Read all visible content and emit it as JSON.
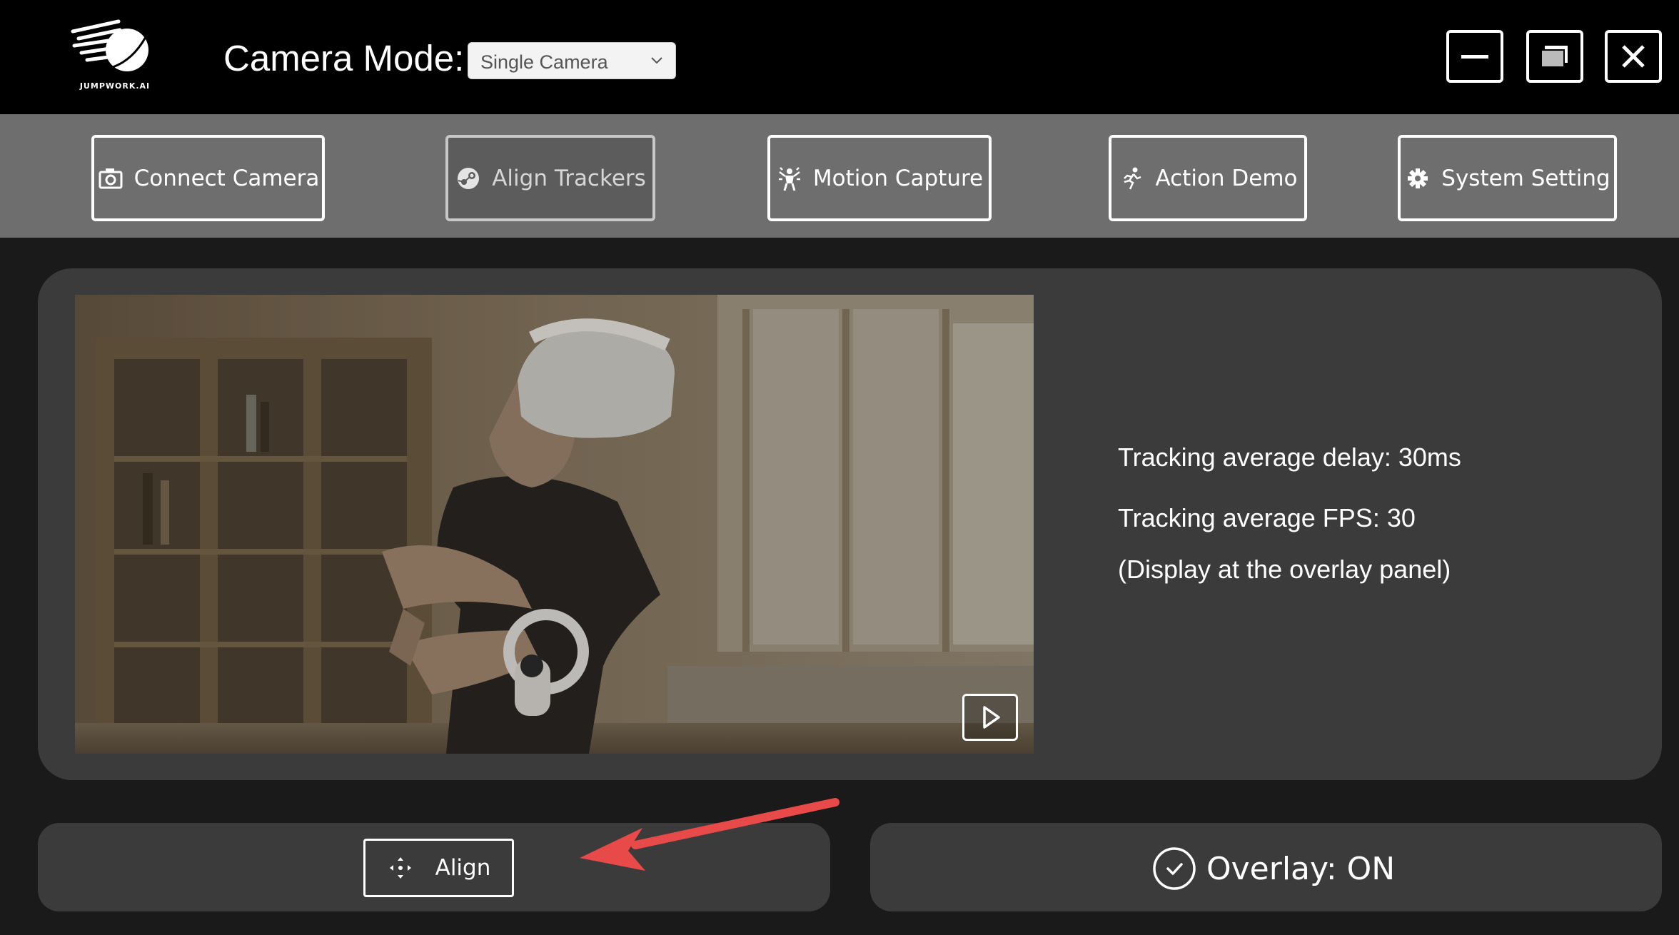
{
  "app": {
    "logo_text": "JUMPWORK.AI",
    "camera_mode_label": "Camera Mode:",
    "camera_mode_value": "Single Camera"
  },
  "window_controls": {
    "icons": [
      "minimize-icon",
      "restore-icon",
      "close-icon"
    ]
  },
  "toolbar": {
    "connect_camera": "Connect Camera",
    "align_trackers": "Align Trackers",
    "motion_capture": "Motion Capture",
    "action_demo": "Action Demo",
    "system_setting": "System Setting"
  },
  "stats": {
    "delay": "Tracking average delay: 30ms",
    "fps": "Tracking average FPS: 30",
    "note": "(Display at the overlay panel)"
  },
  "actions": {
    "align_label": "Align",
    "overlay_label": "Overlay: ON"
  },
  "colors": {
    "titlebar": "#000000",
    "toolbar": "#6e6e6e",
    "panel": "#3b3b3b",
    "background": "#1a1a1a",
    "annotation_arrow": "#e84a4a"
  }
}
